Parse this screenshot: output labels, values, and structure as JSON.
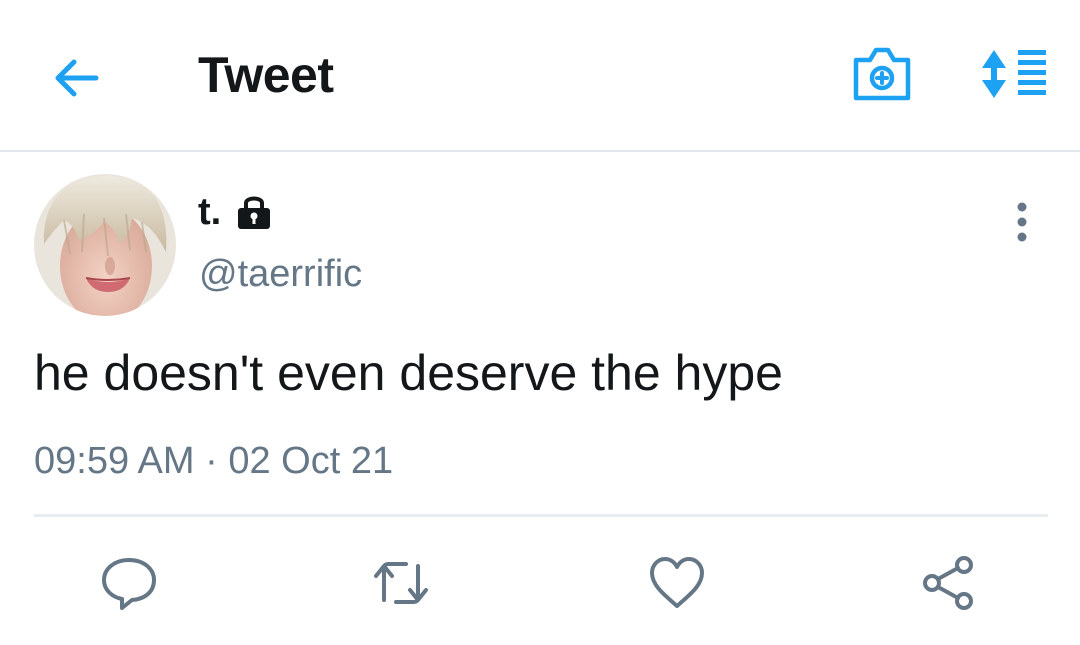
{
  "header": {
    "title": "Tweet",
    "icons": {
      "back": "arrow-left-icon",
      "camera": "camera-plus-icon",
      "sort": "sort-list-icon"
    }
  },
  "tweet": {
    "display_name": "t.",
    "protected_icon": "lock-icon",
    "handle": "@taerrific",
    "text": "he doesn't even deserve the hype",
    "timestamp": "09:59 AM · 02 Oct 21"
  },
  "actions": [
    {
      "name": "reply",
      "icon": "comment-icon"
    },
    {
      "name": "retweet",
      "icon": "retweet-icon"
    },
    {
      "name": "like",
      "icon": "heart-icon"
    },
    {
      "name": "share",
      "icon": "share-icon"
    }
  ],
  "colors": {
    "accent": "#1da1f2",
    "text_primary": "#14171a",
    "text_secondary": "#657786",
    "divider": "#e6ecf0"
  }
}
